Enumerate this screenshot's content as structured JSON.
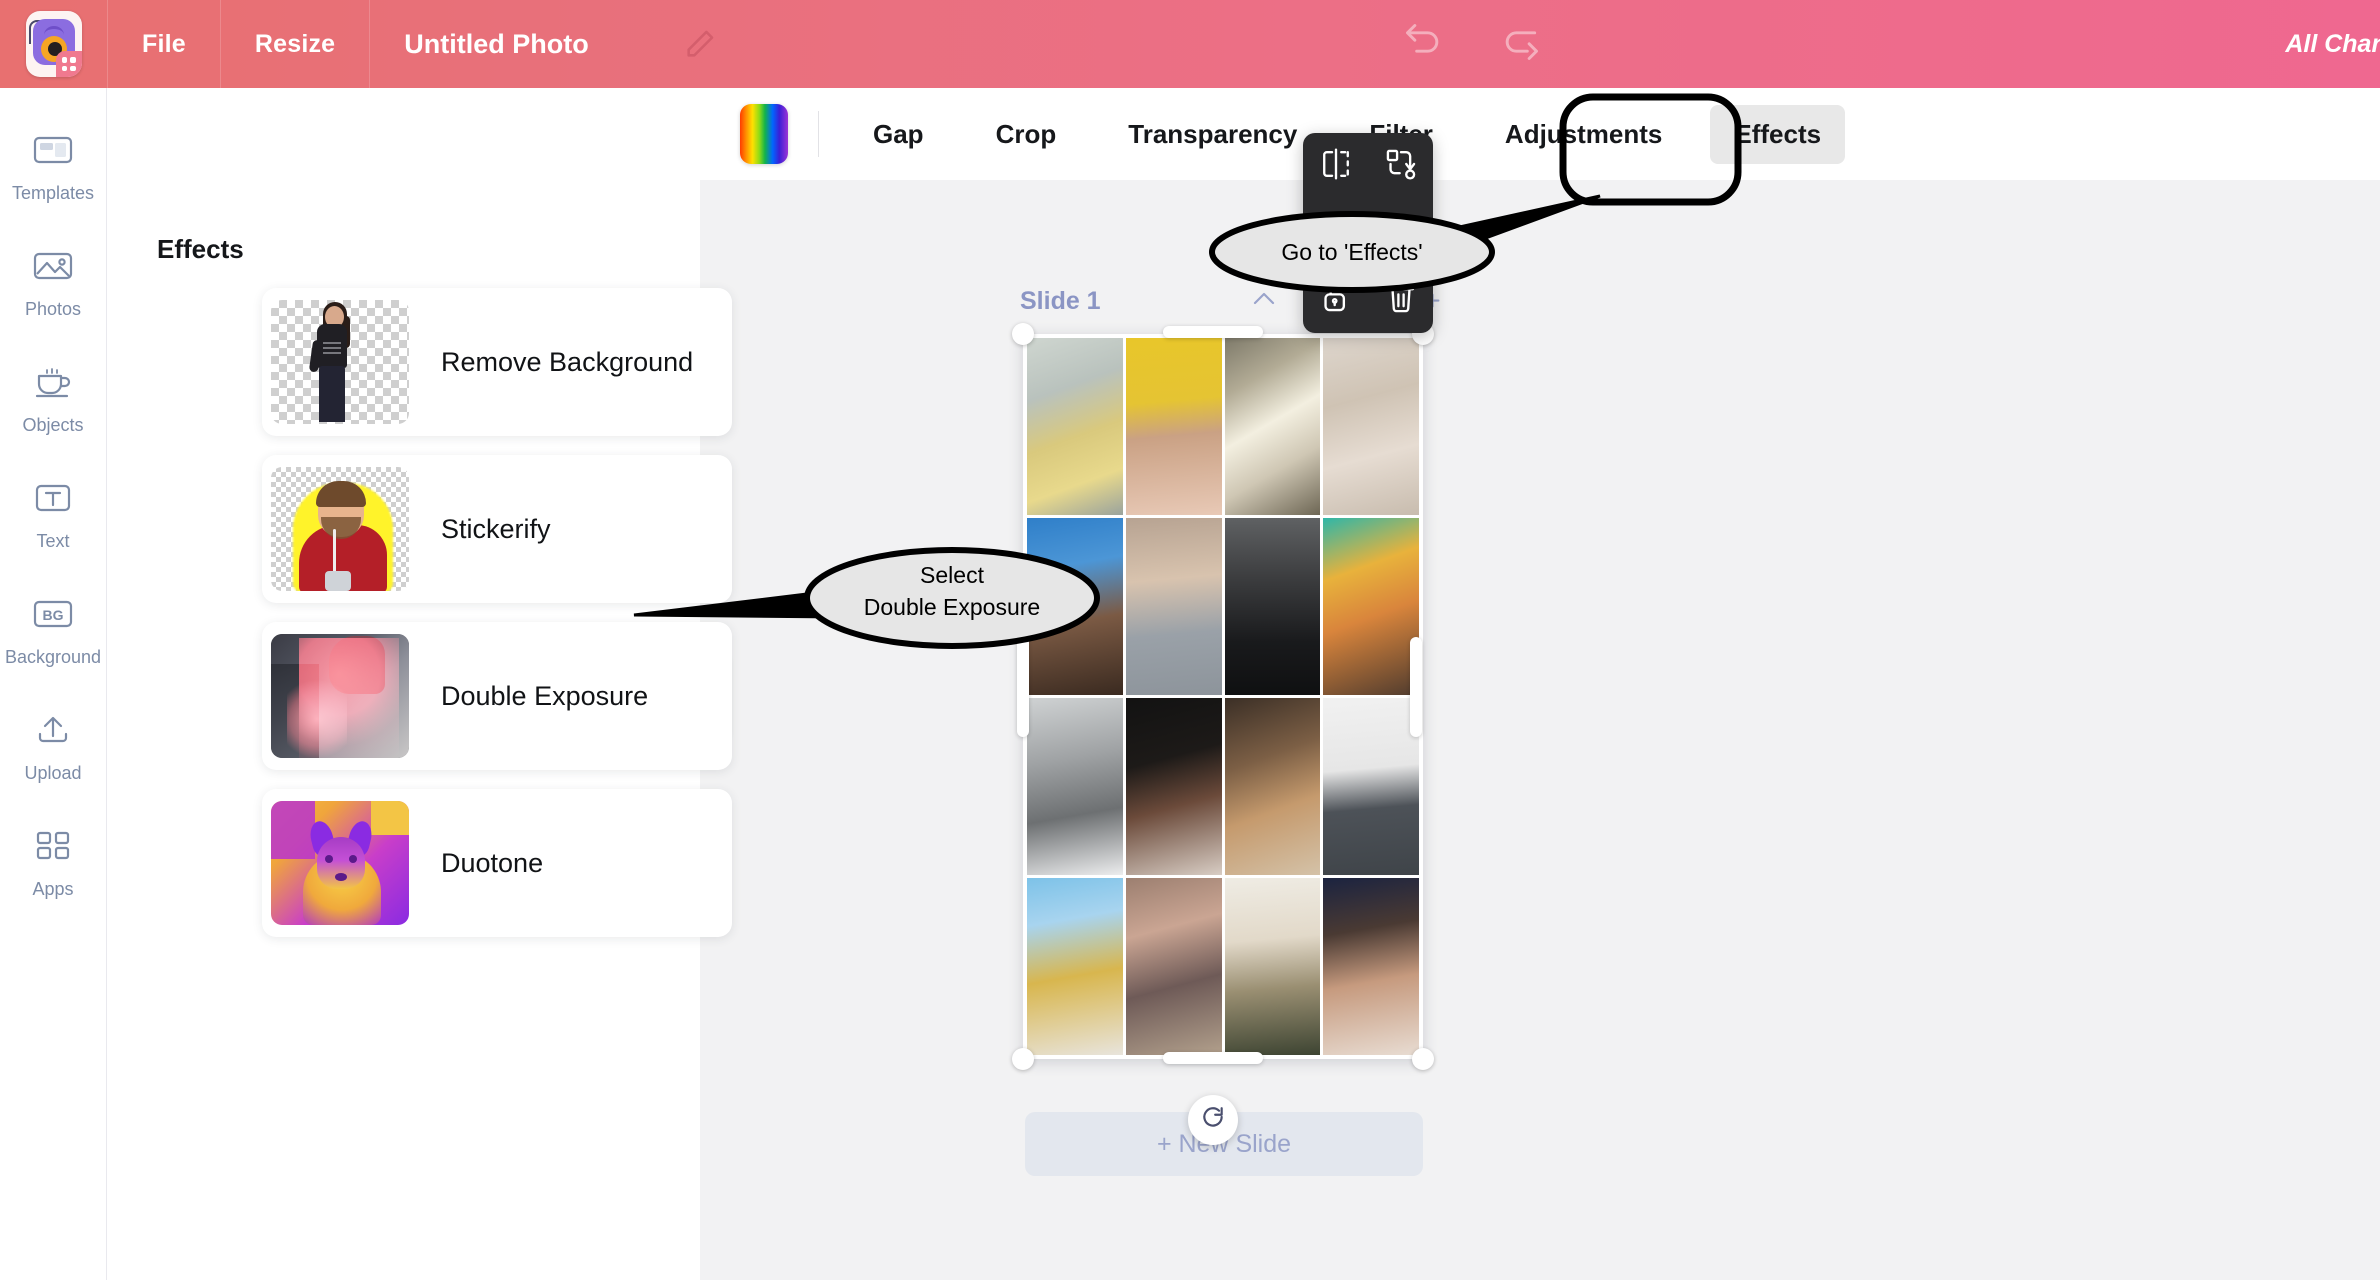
{
  "header": {
    "app_icon": "camera-app-logo",
    "menus": [
      {
        "label": "File",
        "name": "menu-file"
      },
      {
        "label": "Resize",
        "name": "menu-resize"
      }
    ],
    "document_title": "Untitled Photo",
    "edit_title_icon": "pencil-icon",
    "undo_icon": "undo-arrow-icon",
    "redo_icon": "redo-arrow-icon",
    "save_status": "All Chang",
    "gradient_from": "#e87070",
    "gradient_to": "#ef6890"
  },
  "sidebar": {
    "items": [
      {
        "label": "Templates",
        "icon": "templates-icon"
      },
      {
        "label": "Photos",
        "icon": "photos-icon"
      },
      {
        "label": "Objects",
        "icon": "objects-cup-icon"
      },
      {
        "label": "Text",
        "icon": "text-t-icon"
      },
      {
        "label": "Background",
        "icon": "background-bg-icon"
      },
      {
        "label": "Upload",
        "icon": "upload-arrow-icon"
      },
      {
        "label": "Apps",
        "icon": "apps-grid-icon"
      }
    ],
    "label_color": "#7c8ba6"
  },
  "effects_panel": {
    "title": "Effects",
    "cards": [
      {
        "label": "Remove Background",
        "thumb": "woman-transparent-bg-thumb"
      },
      {
        "label": "Stickerify",
        "thumb": "man-red-shirt-sticker-thumb"
      },
      {
        "label": "Double Exposure",
        "thumb": "double-exposure-red-thumb"
      },
      {
        "label": "Duotone",
        "thumb": "duotone-dog-thumb"
      }
    ]
  },
  "toolbar": {
    "color_swatch": "rainbow-gradient-swatch",
    "tabs": [
      {
        "label": "Gap",
        "active": false
      },
      {
        "label": "Crop",
        "active": false
      },
      {
        "label": "Transparency",
        "active": false
      },
      {
        "label": "Filter",
        "active": false
      },
      {
        "label": "Adjustments",
        "active": false
      },
      {
        "label": "Effects",
        "active": true
      }
    ],
    "active_tab": "Effects",
    "active_tab_bg": "#e8e8e8"
  },
  "canvas": {
    "background": "#f2f2f3",
    "collapse_icon": "chevron-left-icon",
    "slide": {
      "title": "Slide 1",
      "actions": [
        {
          "icon": "chevron-up-icon",
          "name": "move-slide-up-button"
        },
        {
          "icon": "chevron-down-icon",
          "name": "move-slide-down-button"
        },
        {
          "icon": "duplicate-icon",
          "name": "duplicate-slide-button"
        },
        {
          "icon": "add-frame-icon",
          "name": "add-slide-button"
        }
      ]
    },
    "new_slide_label": "+ New Slide",
    "rotate_icon": "rotate-icon",
    "collage": {
      "rows": 4,
      "columns": 4,
      "cells": [
        "woman-yellow-floral-dress",
        "woman-yellow-background-portrait",
        "woman-backlit-window",
        "woman-white-dress-flowers",
        "woman-blue-sunglasses-sky",
        "woman-blue-eyes-grey-sweater",
        "woman-black-dress-group",
        "woman-teal-orange-scarf",
        "woman-bw-lying-portrait",
        "woman-dark-profile-braids",
        "woman-gold-necklace-shadow",
        "woman-glasses-grey-tee",
        "woman-hat-sunglasses-flowers",
        "woman-lying-on-bed",
        "woman-blonde-olive-top",
        "girl-braided-hair-portrait"
      ]
    }
  },
  "float_toolbar": {
    "background": "#2b2b2d",
    "buttons": [
      {
        "icon": "flip-horizontal-icon",
        "name": "flip-button"
      },
      {
        "icon": "replace-image-icon",
        "name": "replace-button"
      },
      {
        "icon": "layers-icon",
        "name": "layers-button"
      },
      {
        "icon": "duplicate-icon",
        "name": "duplicate-button"
      },
      {
        "icon": "unlock-icon",
        "name": "lock-button"
      },
      {
        "icon": "trash-icon",
        "name": "delete-button"
      }
    ]
  },
  "annotations": {
    "callout_1": {
      "text": "Go to 'Effects'",
      "target": "effects-tab"
    },
    "callout_2": {
      "line1": "Select",
      "line2": "Double Exposure",
      "target": "double-exposure-card"
    },
    "highlight_box": {
      "target": "effects-tab"
    },
    "stroke_color": "#000000",
    "fill_color": "#e6e6e6"
  }
}
